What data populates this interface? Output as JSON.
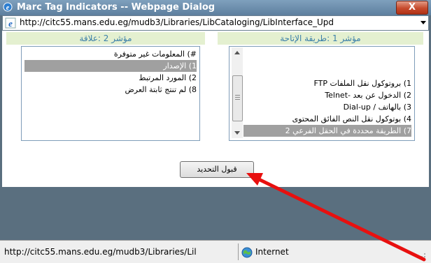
{
  "window": {
    "title": "Marc Tag Indicators -- Webpage Dialog",
    "close_glyph": "X",
    "title_icon": "ie-icon"
  },
  "address": {
    "url": "http://citc55.mans.edu.eg/mudb3/Libraries/LibCataloging/LibInterface_Upd",
    "icon": "ie-icon"
  },
  "indicators": {
    "indicator2": {
      "header": "مؤشر 2 :علاقة",
      "options": [
        {
          "label": "#) المعلومات غير متوفرة",
          "selected": false
        },
        {
          "label": "1) الإصدار",
          "selected": true
        },
        {
          "label": "2) المورد المرتبط",
          "selected": false
        },
        {
          "label": "8) لم تنتج ثابتة العرض",
          "selected": false
        }
      ]
    },
    "indicator1": {
      "header": "مؤشر 1 :طريقة الإتاحة",
      "options": [
        {
          "label": "1) بروتوكول نقل الملفات FTP",
          "selected": false
        },
        {
          "label": "2) الدخول عن بعد -Telnet",
          "selected": false
        },
        {
          "label": "3) بالهاتف / Dial-up",
          "selected": false
        },
        {
          "label": "4) بوتوكول نقل النص الفائق المحتوى",
          "selected": false
        },
        {
          "label": "7) الطريقة محددة في الحقل الفرعي 2",
          "selected": true
        }
      ]
    }
  },
  "accept_button": "قبول التحديد",
  "status": {
    "url": "http://citc55.mans.edu.eg/mudb3/Libraries/Lil",
    "zone": "Internet",
    "zone_icon": "globe-icon"
  },
  "colors": {
    "header_bg": "#e4f0d0",
    "header_text": "#3b7fa8",
    "selected_bg": "#a0a0a0",
    "annotation_arrow": "#e8100f"
  }
}
